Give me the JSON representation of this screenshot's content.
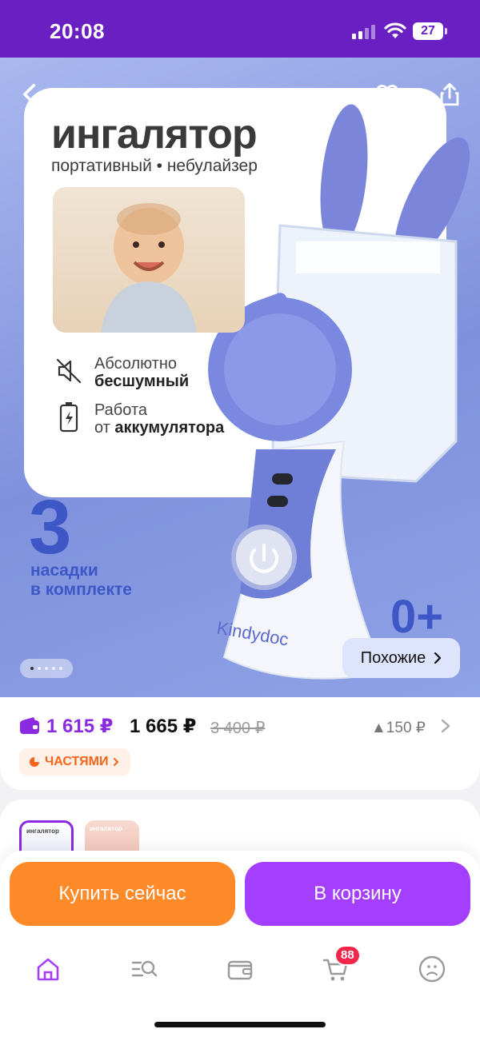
{
  "status_bar": {
    "time": "20:08",
    "battery": "27"
  },
  "hero": {
    "title": "ингалятор",
    "subtitle": "портативный • небулайзер",
    "features": [
      {
        "line1": "Абсолютно",
        "line2": "бесшумный"
      },
      {
        "line1": "Работа",
        "line2_prefix": "от ",
        "line2_bold": "аккумулятора"
      }
    ],
    "big_number": "3",
    "caption_line1": "насадки",
    "caption_line2": "в комплекте",
    "brand": "Kindydoc",
    "age": "0+",
    "similar_label": "Похожие",
    "slide_count": 5,
    "active_slide": 0
  },
  "price": {
    "card_price": "1 615 ₽",
    "current_price": "1 665 ₽",
    "old_price": "3 400 ₽",
    "price_change": "▲150 ₽",
    "parts_label": "ЧАСТЯМИ"
  },
  "gallery": {
    "thumb_label": "ингалятор"
  },
  "actions": {
    "buy_now": "Купить сейчас",
    "add_to_cart": "В корзину"
  },
  "tabbar": {
    "cart_count": "88",
    "items": [
      "home-icon",
      "catalog-search-icon",
      "wallet-icon",
      "cart-icon",
      "profile-icon"
    ]
  },
  "colors": {
    "status_bar": "#6a1fc2",
    "accent_purple": "#a53fff",
    "accent_orange": "#ff8a2a",
    "hero_blue": "#3e57c7",
    "badge_red": "#f3254b"
  }
}
